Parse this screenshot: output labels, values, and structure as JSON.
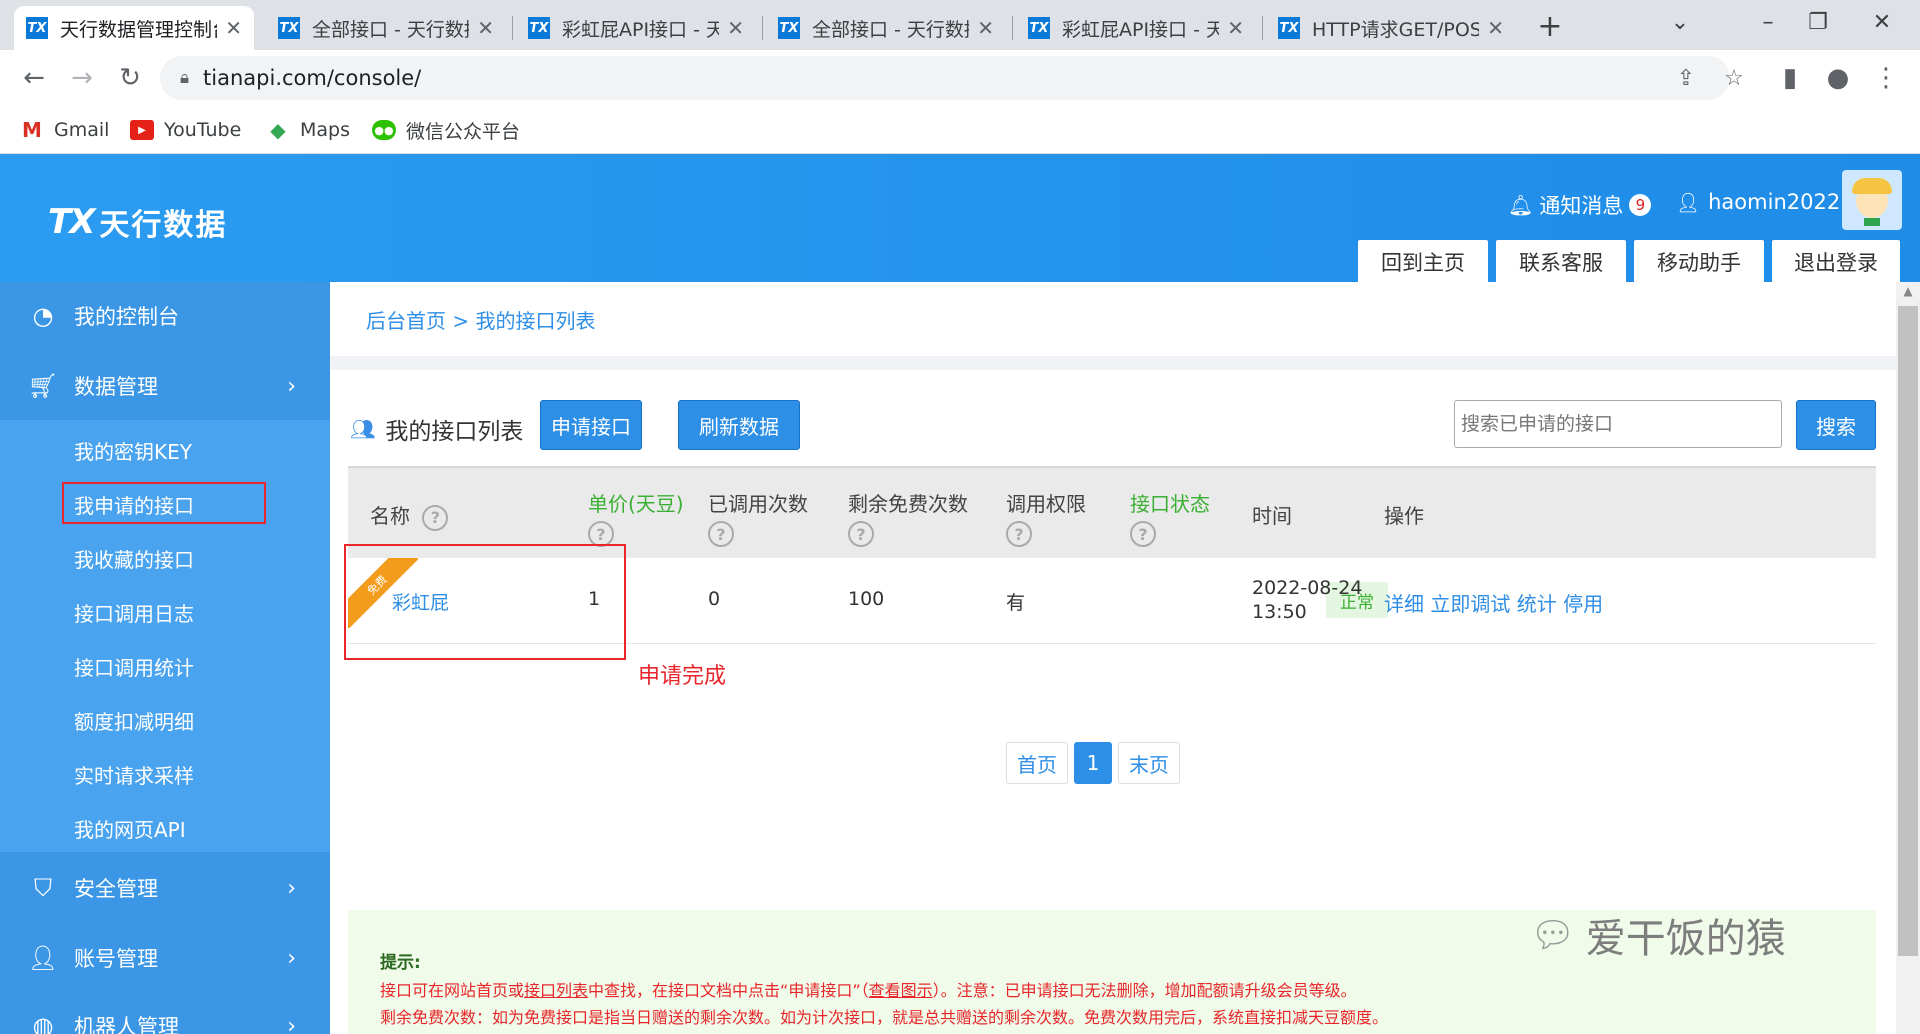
{
  "browser": {
    "tabs": [
      {
        "title": "天行数据管理控制台",
        "favicon": "TX"
      },
      {
        "title": "全部接口 - 天行数据",
        "favicon": "TX"
      },
      {
        "title": "彩虹屁API接口 - 天",
        "favicon": "TX"
      },
      {
        "title": "全部接口 - 天行数据",
        "favicon": "TX"
      },
      {
        "title": "彩虹屁API接口 - 天",
        "favicon": "TX"
      },
      {
        "title": "HTTP请求GET/POST",
        "favicon": "TX"
      }
    ],
    "close_glyph": "✕",
    "new_tab_glyph": "+",
    "address": "tianapi.com/console/",
    "bookmarks": [
      {
        "label": "Gmail",
        "icon": "gmail-icon"
      },
      {
        "label": "YouTube",
        "icon": "youtube-icon"
      },
      {
        "label": "Maps",
        "icon": "maps-icon"
      },
      {
        "label": "微信公众平台",
        "icon": "wechat-icon"
      }
    ]
  },
  "site": {
    "logo_mark": "TX",
    "logo_text": "天行数据",
    "notice_label": "通知消息",
    "notice_count": "9",
    "username": "haomin2022",
    "header_buttons": [
      "回到主页",
      "联系客服",
      "移动助手",
      "退出登录"
    ]
  },
  "sidebar": {
    "main": [
      {
        "label": "我的控制台",
        "icon": "dashboard-icon"
      },
      {
        "label": "数据管理",
        "icon": "cart-icon"
      },
      {
        "label": "安全管理",
        "icon": "shield-icon"
      },
      {
        "label": "账号管理",
        "icon": "user-icon"
      },
      {
        "label": "机器人管理",
        "icon": "robot-icon"
      }
    ],
    "sub": [
      "我的密钥KEY",
      "我申请的接口",
      "我收藏的接口",
      "接口调用日志",
      "接口调用统计",
      "额度扣减明细",
      "实时请求采样",
      "我的网页API"
    ],
    "chevron": "›"
  },
  "content": {
    "breadcrumb": "后台首页 > 我的接口列表",
    "list_title": "我的接口列表",
    "apply_btn": "申请接口",
    "refresh_btn": "刷新数据",
    "search_placeholder": "搜索已申请的接口",
    "search_btn": "搜索",
    "table": {
      "headers": [
        "名称",
        "单价(天豆)",
        "已调用次数",
        "剩余免费次数",
        "调用权限",
        "接口状态",
        "时间",
        "操作"
      ],
      "help_glyph": "?",
      "row": {
        "tag": "免费",
        "name": "彩虹屁",
        "price": "1",
        "called": "0",
        "remaining": "100",
        "permission": "有",
        "status": "正常",
        "date": "2022-08-24",
        "time": "13:50",
        "actions": [
          "详细",
          "立即调试",
          "统计",
          "停用"
        ]
      }
    },
    "annotation": "申请完成",
    "pager": {
      "first": "首页",
      "current": "1",
      "last": "末页"
    },
    "tips": {
      "title": "提示:",
      "line1_a": "接口可在网站首页或",
      "line1_link1": "接口列表",
      "line1_b": "中查找，在接口文档中点击“申请接口”（",
      "line1_link2": "查看图示",
      "line1_c": "）。注意：已申请接口无法删除，增加配额请升级会员等级。",
      "line2": "剩余免费次数：如为免费接口是指当日赠送的剩余次数。如为计次接口，就是总共赠送的剩余次数。免费次数用完后，系统直接扣减天豆额度。"
    },
    "watermark": "爱干饭的猿"
  },
  "colors": {
    "brand_blue": "#2d8fe6",
    "accent_red": "#e8262b",
    "status_green": "#3cb035"
  }
}
